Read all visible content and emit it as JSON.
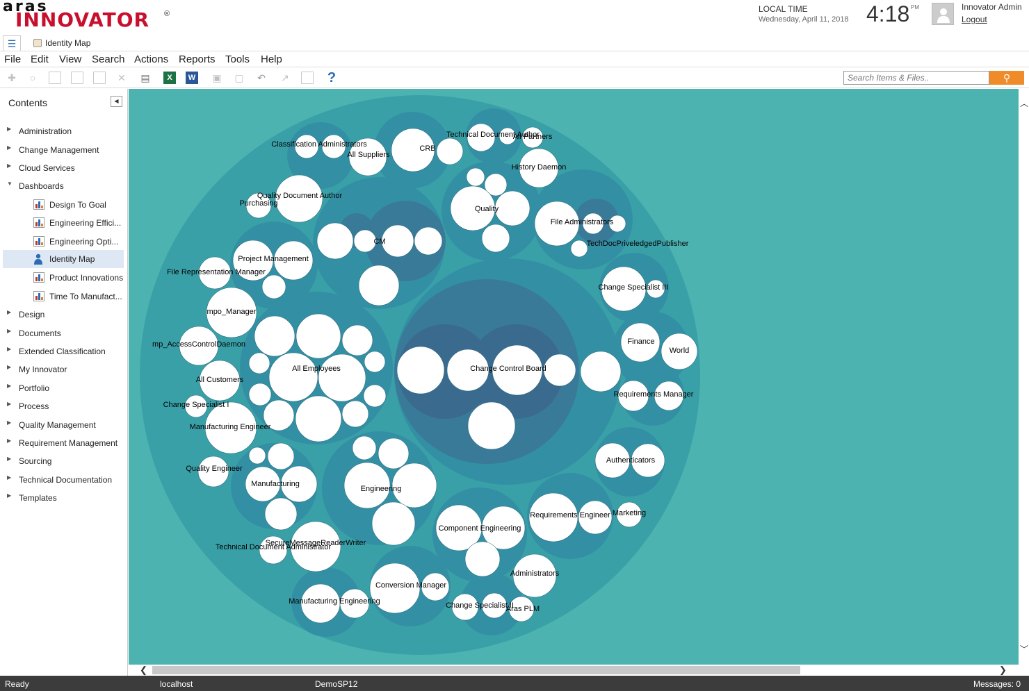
{
  "brand": {
    "aras": "aras",
    "innovator": "INNOVATOR",
    "reg": "®"
  },
  "clock": {
    "label": "LOCAL TIME",
    "date": "Wednesday, April 11, 2018",
    "time": "4:18",
    "ampm": "PM"
  },
  "user": {
    "name": "Innovator Admin",
    "logout": "Logout"
  },
  "tab": {
    "title": "Identity Map"
  },
  "menu": [
    "File",
    "Edit",
    "View",
    "Search",
    "Actions",
    "Reports",
    "Tools",
    "Help"
  ],
  "toolbar": {
    "search_placeholder": "Search Items & Files..",
    "icons": [
      "new-icon",
      "search-item-icon",
      "edit-icon",
      "save-icon",
      "save-close-icon",
      "discard-icon",
      "print-icon",
      "excel-icon",
      "word-icon",
      "lock-icon",
      "unlock-icon",
      "undo-icon",
      "promote-icon",
      "version-icon",
      "help-icon"
    ]
  },
  "sidebar": {
    "title": "Contents",
    "items": [
      {
        "label": "Administration"
      },
      {
        "label": "Change Management"
      },
      {
        "label": "Cloud Services"
      },
      {
        "label": "Dashboards",
        "expanded": true
      },
      {
        "label": "Design"
      },
      {
        "label": "Documents"
      },
      {
        "label": "Extended Classification"
      },
      {
        "label": "My Innovator"
      },
      {
        "label": "Portfolio"
      },
      {
        "label": "Process"
      },
      {
        "label": "Quality Management"
      },
      {
        "label": "Requirement Management"
      },
      {
        "label": "Sourcing"
      },
      {
        "label": "Technical Documentation"
      },
      {
        "label": "Templates"
      }
    ],
    "dashboards": [
      {
        "label": "Design To Goal"
      },
      {
        "label": "Engineering Effici..."
      },
      {
        "label": "Engineering Opti..."
      },
      {
        "label": "Identity Map",
        "selected": true
      },
      {
        "label": "Product Innovations"
      },
      {
        "label": "Time To Manufact..."
      }
    ]
  },
  "identity_map": {
    "labels": [
      "Classification Administrators",
      "All Suppliers",
      "CRB",
      "Technical Document Author",
      "All Partners",
      "History Daemon",
      "Quality Document Author",
      "Purchasing",
      "Quality",
      "File Administrators",
      "TechDocPriveledgedPublisher",
      "CM",
      "Project Management",
      "File Representation Manager",
      "Change Specialist III",
      "Finance",
      "World",
      "mpo_Manager",
      "mp_AccessControlDaemon",
      "All Employees",
      "Change Control Board",
      "All Customers",
      "Requirements Manager",
      "Change Specialist I",
      "Manufacturing Engineer",
      "Authenticators",
      "Quality Engineer",
      "Manufacturing",
      "Engineering",
      "Requirements Engineer",
      "Marketing",
      "Component Engineering",
      "SecureMessageReaderWriter",
      "Technical Document Administrator",
      "Administrators",
      "Conversion Manager",
      "Manufacturing Engineering",
      "Change Specialist II",
      "Aras PLM"
    ],
    "colors": {
      "background": "#4db3b0",
      "group_outer": "#3aa0a8",
      "group_mid": "#3390a4",
      "group_inner": "#3a7a99",
      "group_deep": "#3a6a8e",
      "leaf": "#ffffff"
    }
  },
  "status": {
    "ready": "Ready",
    "server": "localhost",
    "database": "DemoSP12",
    "messages": "Messages:  0"
  }
}
